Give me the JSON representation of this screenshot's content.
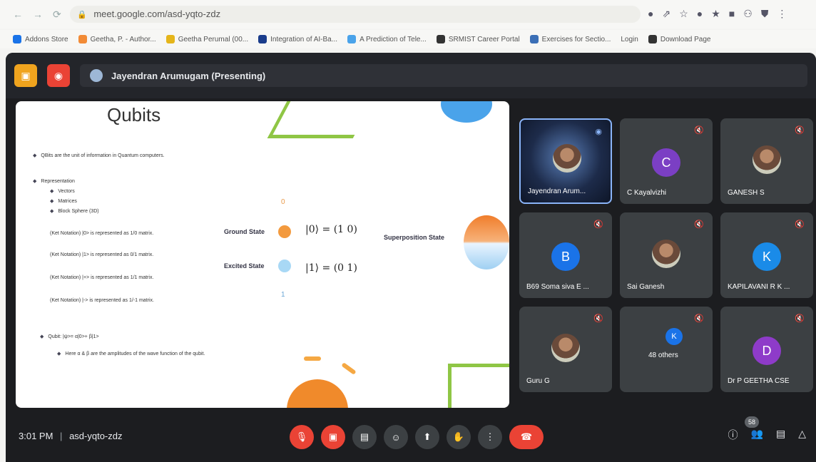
{
  "browser": {
    "url": "meet.google.com/asd-yqto-zdz",
    "nav": {
      "back": "←",
      "forward": "→",
      "reload": "⟳"
    },
    "ext_icons": [
      "●",
      "⇗",
      "☆",
      "●",
      "★",
      "■",
      "⚇",
      "⛊",
      "⋮"
    ],
    "bookmarks": [
      {
        "label": "Addons Store",
        "color": "#1a73e8"
      },
      {
        "label": "Geetha, P. - Author...",
        "color": "#f28b36"
      },
      {
        "label": "Geetha Perumal (00...",
        "color": "#e5b51a"
      },
      {
        "label": "Integration of AI-Ba...",
        "color": "#1a3c8b"
      },
      {
        "label": "A Prediction of Tele...",
        "color": "#4aa3ea"
      },
      {
        "label": "SRMIST Career Portal",
        "color": "#333333"
      },
      {
        "label": "Exercises for Sectio...",
        "color": "#3b6fb6"
      },
      {
        "label": "Login",
        "color": ""
      },
      {
        "label": "Download Page",
        "color": "#333333"
      }
    ]
  },
  "meet": {
    "presenting_text": "Jayendran Arumugam (Presenting)",
    "slide": {
      "title": "Qubits",
      "bullet1": "QBits are the unit of information in Quantum computers.",
      "representation": "Representation",
      "sub": [
        "Vectors",
        "Matrices",
        "Block Sphere (3D)"
      ],
      "ket_lines": [
        "(Ket Notation) |0> is represented as 1/0 matrix.",
        "(Ket Notation) |1> is represented as 0/1 matrix.",
        "(Ket Notation) |+> is represented as 1/1 matrix.",
        "(Ket Notation) |-> is represented as 1/-1 matrix."
      ],
      "qubit_line": "Qubit: |ψ>= α|0>+ β|1>",
      "qubit_sub": "Here α & β are the amplitudes of the wave function of the qubit.",
      "ground_state": "Ground State",
      "excited_state": "Excited State",
      "superposition": "Superposition State",
      "ket0": "|0⟩ = (1 0)",
      "ket1": "|1⟩ = (0 1)",
      "label0": "0",
      "label1": "1"
    },
    "participants": [
      {
        "name": "Jayendran Arum...",
        "type": "video"
      },
      {
        "name": "C Kayalvizhi",
        "initial": "C",
        "color": "#7b3fc4"
      },
      {
        "name": "GANESH S",
        "type": "photo"
      },
      {
        "name": "B69 Soma siva E ...",
        "initial": "B",
        "color": "#1a73e8"
      },
      {
        "name": "Sai Ganesh",
        "type": "photo"
      },
      {
        "name": "KAPILAVANI R K ...",
        "initial": "K",
        "color": "#1a8be8"
      },
      {
        "name": "Guru G",
        "type": "photo"
      },
      {
        "name": "48 others",
        "initial": "K",
        "color": "#1a73e8"
      },
      {
        "name": "Dr P GEETHA CSE",
        "initial": "D",
        "color": "#8e3bc9"
      }
    ],
    "time": "3:01 PM",
    "meeting_code": "asd-yqto-zdz",
    "participant_count": "58"
  }
}
